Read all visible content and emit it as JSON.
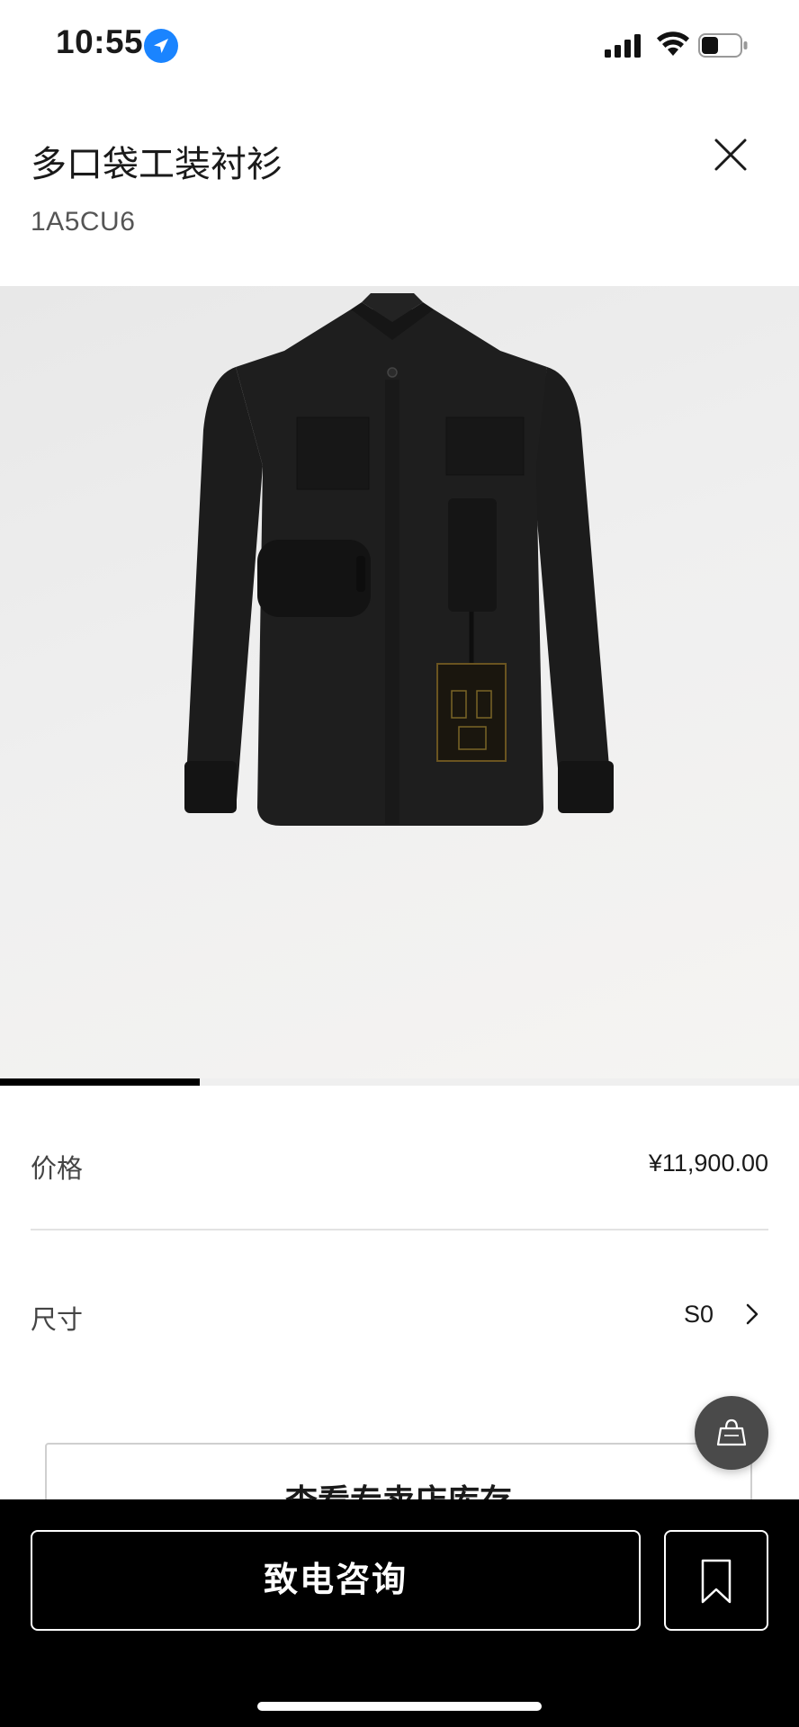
{
  "status_bar": {
    "time": "10:55",
    "location_icon": "location-arrow-icon",
    "signal_icon": "cellular-signal-icon",
    "wifi_icon": "wifi-icon",
    "battery_icon": "battery-icon",
    "battery_level": 0.45
  },
  "header": {
    "title": "多口袋工装衬衫",
    "sku": "1A5CU6",
    "close_icon": "close-icon"
  },
  "gallery": {
    "image_alt": "product-shirt-image",
    "current_index": 1,
    "progress": 0.25
  },
  "details": {
    "price_label": "价格",
    "price_value": "¥11,900.00",
    "size_label": "尺寸",
    "size_value": "S0",
    "size_chevron_icon": "chevron-right-icon"
  },
  "actions": {
    "stock_label": "查看专卖店库存",
    "call_label": "致电咨询",
    "bookmark_icon": "bookmark-icon",
    "bag_icon": "shopping-bag-icon"
  },
  "colors": {
    "accent": "#000000",
    "location_blue": "#1a84ff",
    "fab": "#4a4a4a"
  }
}
